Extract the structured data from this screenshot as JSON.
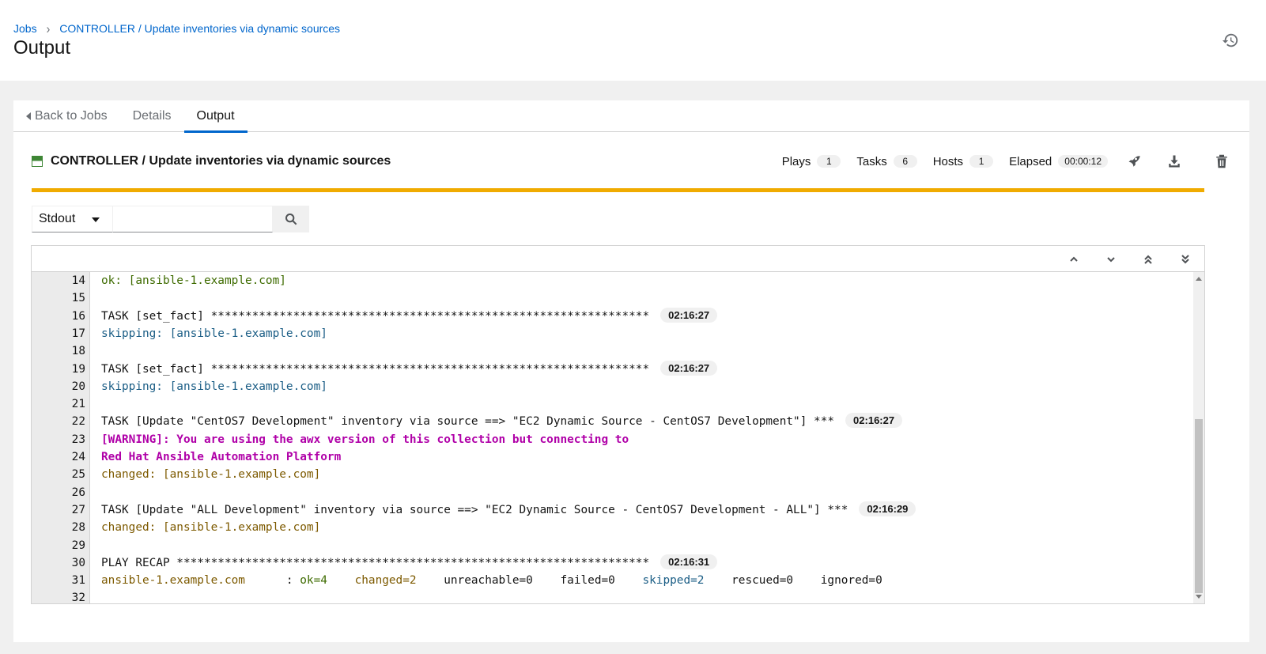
{
  "breadcrumb": {
    "jobs": "Jobs",
    "current": "CONTROLLER / Update inventories via dynamic sources"
  },
  "page_title": "Output",
  "tabs": {
    "back": "Back to Jobs",
    "details": "Details",
    "output": "Output"
  },
  "job": {
    "title": "CONTROLLER / Update inventories via dynamic sources",
    "plays_label": "Plays",
    "plays": "1",
    "tasks_label": "Tasks",
    "tasks": "6",
    "hosts_label": "Hosts",
    "hosts": "1",
    "elapsed_label": "Elapsed",
    "elapsed": "00:00:12",
    "status_color": "#3e8635",
    "progress_color": "#f0ab00"
  },
  "search": {
    "type": "Stdout",
    "value": ""
  },
  "output_lines": [
    {
      "n": "14",
      "text": "ok: [ansible-1.example.com]",
      "style": "ok"
    },
    {
      "n": "15",
      "text": "",
      "style": "plain"
    },
    {
      "n": "16",
      "text": "TASK [set_fact] ****************************************************************",
      "style": "plain",
      "time": "02:16:27"
    },
    {
      "n": "17",
      "text": "skipping: [ansible-1.example.com]",
      "style": "skip"
    },
    {
      "n": "18",
      "text": "",
      "style": "plain"
    },
    {
      "n": "19",
      "text": "TASK [set_fact] ****************************************************************",
      "style": "plain",
      "time": "02:16:27"
    },
    {
      "n": "20",
      "text": "skipping: [ansible-1.example.com]",
      "style": "skip"
    },
    {
      "n": "21",
      "text": "",
      "style": "plain"
    },
    {
      "n": "22",
      "text": "TASK [Update \"CentOS7 Development\" inventory via source ==> \"EC2 Dynamic Source - CentOS7 Development\"] ***",
      "style": "plain",
      "time": "02:16:27"
    },
    {
      "n": "23",
      "text": "[WARNING]: You are using the awx version of this collection but connecting to",
      "style": "warn"
    },
    {
      "n": "24",
      "text": "Red Hat Ansible Automation Platform",
      "style": "warn"
    },
    {
      "n": "25",
      "text": "changed: [ansible-1.example.com]",
      "style": "changed"
    },
    {
      "n": "26",
      "text": "",
      "style": "plain"
    },
    {
      "n": "27",
      "text": "TASK [Update \"ALL Development\" inventory via source ==> \"EC2 Dynamic Source - CentOS7 Development - ALL\"] ***",
      "style": "plain",
      "time": "02:16:29"
    },
    {
      "n": "28",
      "text": "changed: [ansible-1.example.com]",
      "style": "changed"
    },
    {
      "n": "29",
      "text": "",
      "style": "plain"
    },
    {
      "n": "30",
      "text": "PLAY RECAP *********************************************************************",
      "style": "plain",
      "time": "02:16:31"
    },
    {
      "n": "31",
      "recap": true,
      "host": "ansible-1.example.com",
      "colon": "      : ",
      "ok": "ok=4",
      "changed": "changed=2",
      "unreachable": "unreachable=0",
      "failed": "failed=0",
      "skipped": "skipped=2",
      "rescued": "rescued=0",
      "ignored": "ignored=0"
    },
    {
      "n": "32",
      "text": "",
      "style": "plain"
    }
  ]
}
